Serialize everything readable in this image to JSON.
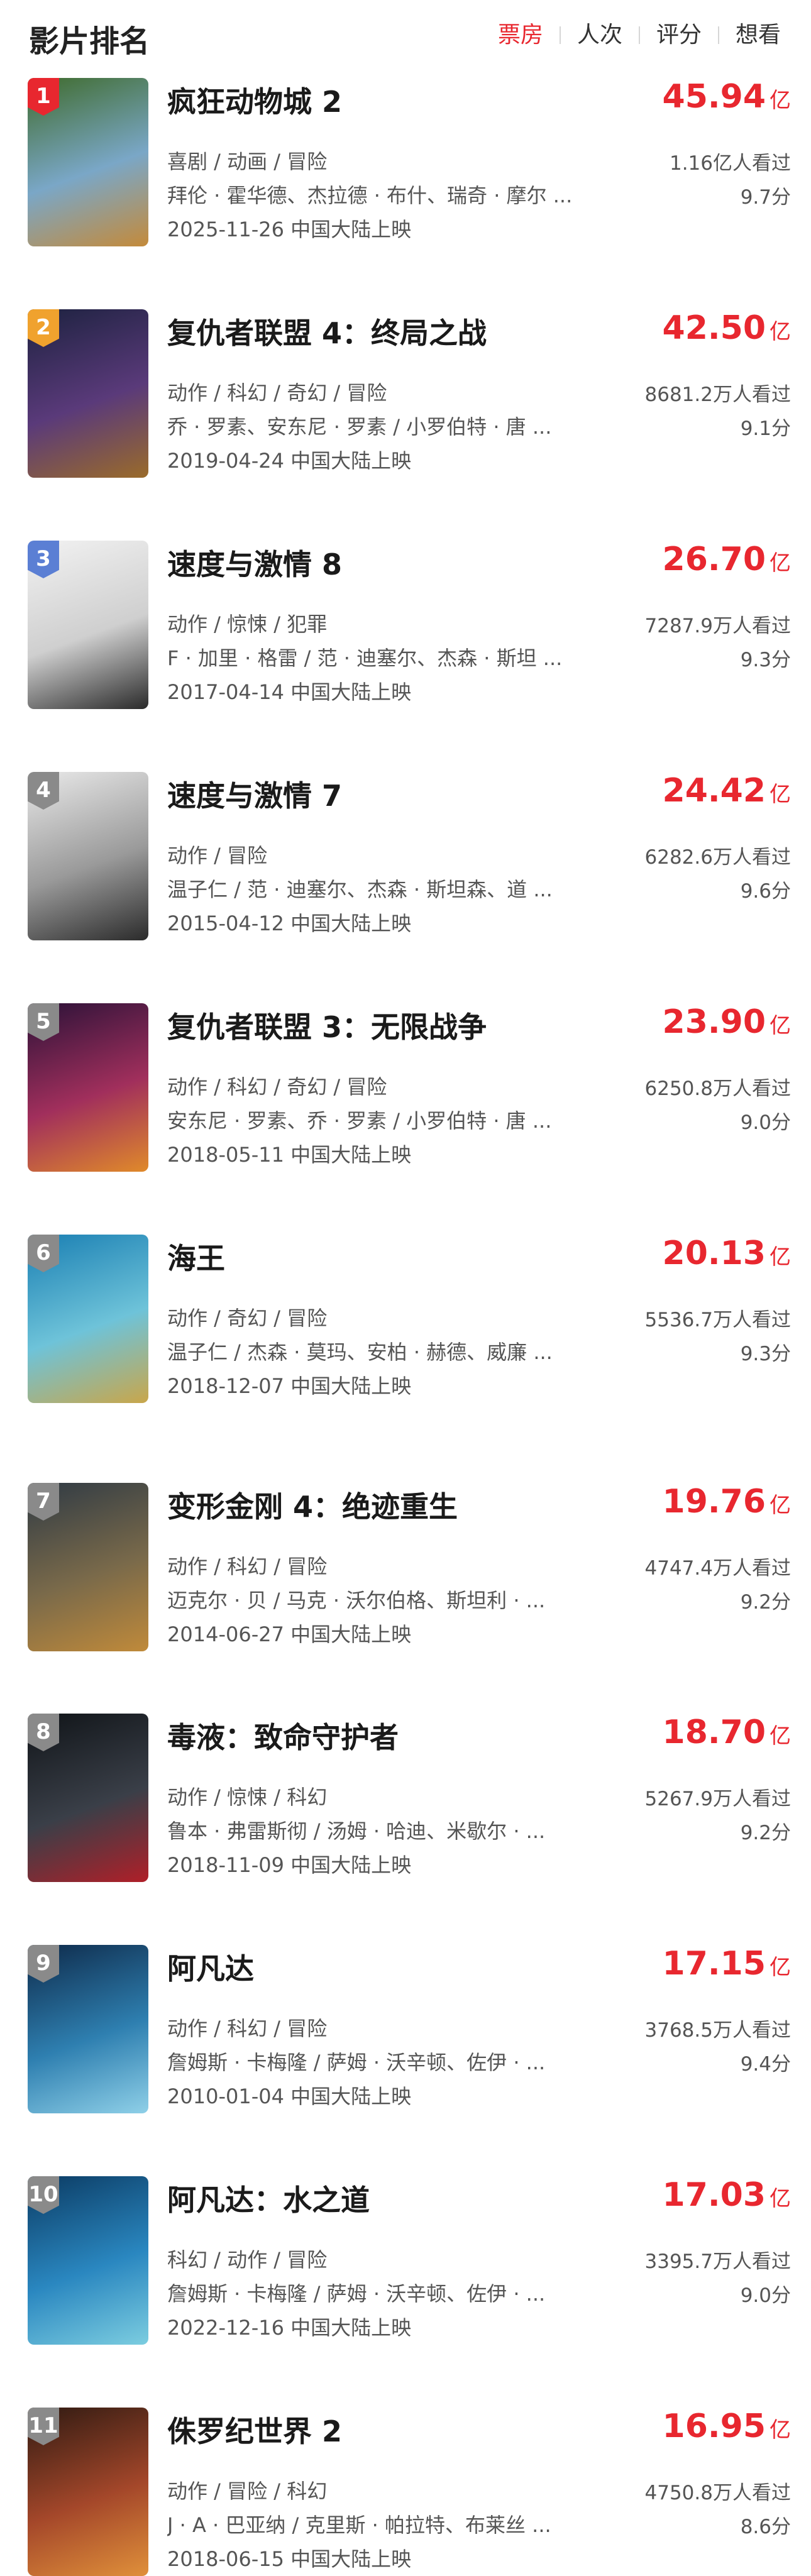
{
  "header": {
    "title": "影片排名",
    "tabs": [
      "票房",
      "人次",
      "评分",
      "想看"
    ],
    "active_tab": "票房"
  },
  "colors": {
    "accent": "#e8272f"
  },
  "movies": [
    {
      "rank": "1",
      "title": "疯狂动物城 2",
      "box_office": "45.94",
      "unit": "亿",
      "genre": "喜剧 / 动画 / 冒险",
      "cast": "拜伦 · 霍华德、杰拉德 · 布什、瑞奇 · 摩尔 ...",
      "release": "2025-11-26 中国大陆上映",
      "views": "1.16亿人看过",
      "score": "9.7分",
      "badge_color": "#e8272f",
      "poster": [
        "#3f6b2c",
        "#7aa7c7",
        "#c48a3a"
      ]
    },
    {
      "rank": "2",
      "title": "复仇者联盟 4：终局之战",
      "box_office": "42.50",
      "unit": "亿",
      "genre": "动作 / 科幻 / 奇幻 / 冒险",
      "cast": "乔 · 罗素、安东尼 · 罗素 / 小罗伯特 · 唐 ...",
      "release": "2019-04-24 中国大陆上映",
      "views": "8681.2万人看过",
      "score": "9.1分",
      "badge_color": "#f0a22e",
      "poster": [
        "#1d2240",
        "#5a3a7a",
        "#9a6b2a"
      ]
    },
    {
      "rank": "3",
      "title": "速度与激情 8",
      "box_office": "26.70",
      "unit": "亿",
      "genre": "动作 / 惊悚 / 犯罪",
      "cast": "F · 加里 · 格雷 / 范 · 迪塞尔、杰森 · 斯坦 ...",
      "release": "2017-04-14 中国大陆上映",
      "views": "7287.9万人看过",
      "score": "9.3分",
      "badge_color": "#5b7fd4",
      "poster": [
        "#f2f2f2",
        "#cfcfcf",
        "#2a2a2a"
      ]
    },
    {
      "rank": "4",
      "title": "速度与激情 7",
      "box_office": "24.42",
      "unit": "亿",
      "genre": "动作 / 冒险",
      "cast": "温子仁 / 范 · 迪塞尔、杰森 · 斯坦森、道 ...",
      "release": "2015-04-12 中国大陆上映",
      "views": "6282.6万人看过",
      "score": "9.6分",
      "badge_color": "#8a8a8a",
      "poster": [
        "#e9e9e9",
        "#9a9a9a",
        "#2b2b2b"
      ]
    },
    {
      "rank": "5",
      "title": "复仇者联盟 3：无限战争",
      "box_office": "23.90",
      "unit": "亿",
      "genre": "动作 / 科幻 / 奇幻 / 冒险",
      "cast": "安东尼 · 罗素、乔 · 罗素 / 小罗伯特 · 唐 ...",
      "release": "2018-05-11 中国大陆上映",
      "views": "6250.8万人看过",
      "score": "9.0分",
      "badge_color": "#8a8a8a",
      "poster": [
        "#2b1238",
        "#a12f5c",
        "#e08a2a"
      ]
    },
    {
      "rank": "6",
      "title": "海王",
      "box_office": "20.13",
      "unit": "亿",
      "genre": "动作 / 奇幻 / 冒险",
      "cast": "温子仁 / 杰森 · 莫玛、安柏 · 赫德、威廉 ...",
      "release": "2018-12-07 中国大陆上映",
      "views": "5536.7万人看过",
      "score": "9.3分",
      "badge_color": "#8a8a8a",
      "poster": [
        "#1a7fb3",
        "#6ec3d9",
        "#c9a64a"
      ]
    },
    {
      "rank": "7",
      "title": "变形金刚 4：绝迹重生",
      "box_office": "19.76",
      "unit": "亿",
      "genre": "动作 / 科幻 / 冒险",
      "cast": "迈克尔 · 贝 / 马克 · 沃尔伯格、斯坦利 · ...",
      "release": "2014-06-27 中国大陆上映",
      "views": "4747.4万人看过",
      "score": "9.2分",
      "badge_color": "#8a8a8a",
      "poster": [
        "#2f3a44",
        "#7a6a4a",
        "#c08a3a"
      ]
    },
    {
      "rank": "8",
      "title": "毒液：致命守护者",
      "box_office": "18.70",
      "unit": "亿",
      "genre": "动作 / 惊悚 / 科幻",
      "cast": "鲁本 · 弗雷斯彻 / 汤姆 · 哈迪、米歇尔 · ...",
      "release": "2018-11-09 中国大陆上映",
      "views": "5267.9万人看过",
      "score": "9.2分",
      "badge_color": "#8a8a8a",
      "poster": [
        "#101418",
        "#3a3f48",
        "#b01f28"
      ]
    },
    {
      "rank": "9",
      "title": "阿凡达",
      "box_office": "17.15",
      "unit": "亿",
      "genre": "动作 / 科幻 / 冒险",
      "cast": "詹姆斯 · 卡梅隆 / 萨姆 · 沃辛顿、佐伊 · ...",
      "release": "2010-01-04 中国大陆上映",
      "views": "3768.5万人看过",
      "score": "9.4分",
      "badge_color": "#8a8a8a",
      "poster": [
        "#0e2a4a",
        "#2e7fb0",
        "#8fd0e8"
      ]
    },
    {
      "rank": "10",
      "title": "阿凡达：水之道",
      "box_office": "17.03",
      "unit": "亿",
      "genre": "科幻 / 动作 / 冒险",
      "cast": "詹姆斯 · 卡梅隆 / 萨姆 · 沃辛顿、佐伊 · ...",
      "release": "2022-12-16 中国大陆上映",
      "views": "3395.7万人看过",
      "score": "9.0分",
      "badge_color": "#8a8a8a",
      "poster": [
        "#0b3b63",
        "#2a87c0",
        "#7ccde0"
      ]
    },
    {
      "rank": "11",
      "title": "侏罗纪世界 2",
      "box_office": "16.95",
      "unit": "亿",
      "genre": "动作 / 冒险 / 科幻",
      "cast": "J · A · 巴亚纳 / 克里斯 · 帕拉特、布莱丝 ...",
      "release": "2018-06-15 中国大陆上映",
      "views": "4750.8万人看过",
      "score": "8.6分",
      "badge_color": "#8a8a8a",
      "poster": [
        "#2f1a12",
        "#a4472a",
        "#e0903a"
      ]
    }
  ]
}
